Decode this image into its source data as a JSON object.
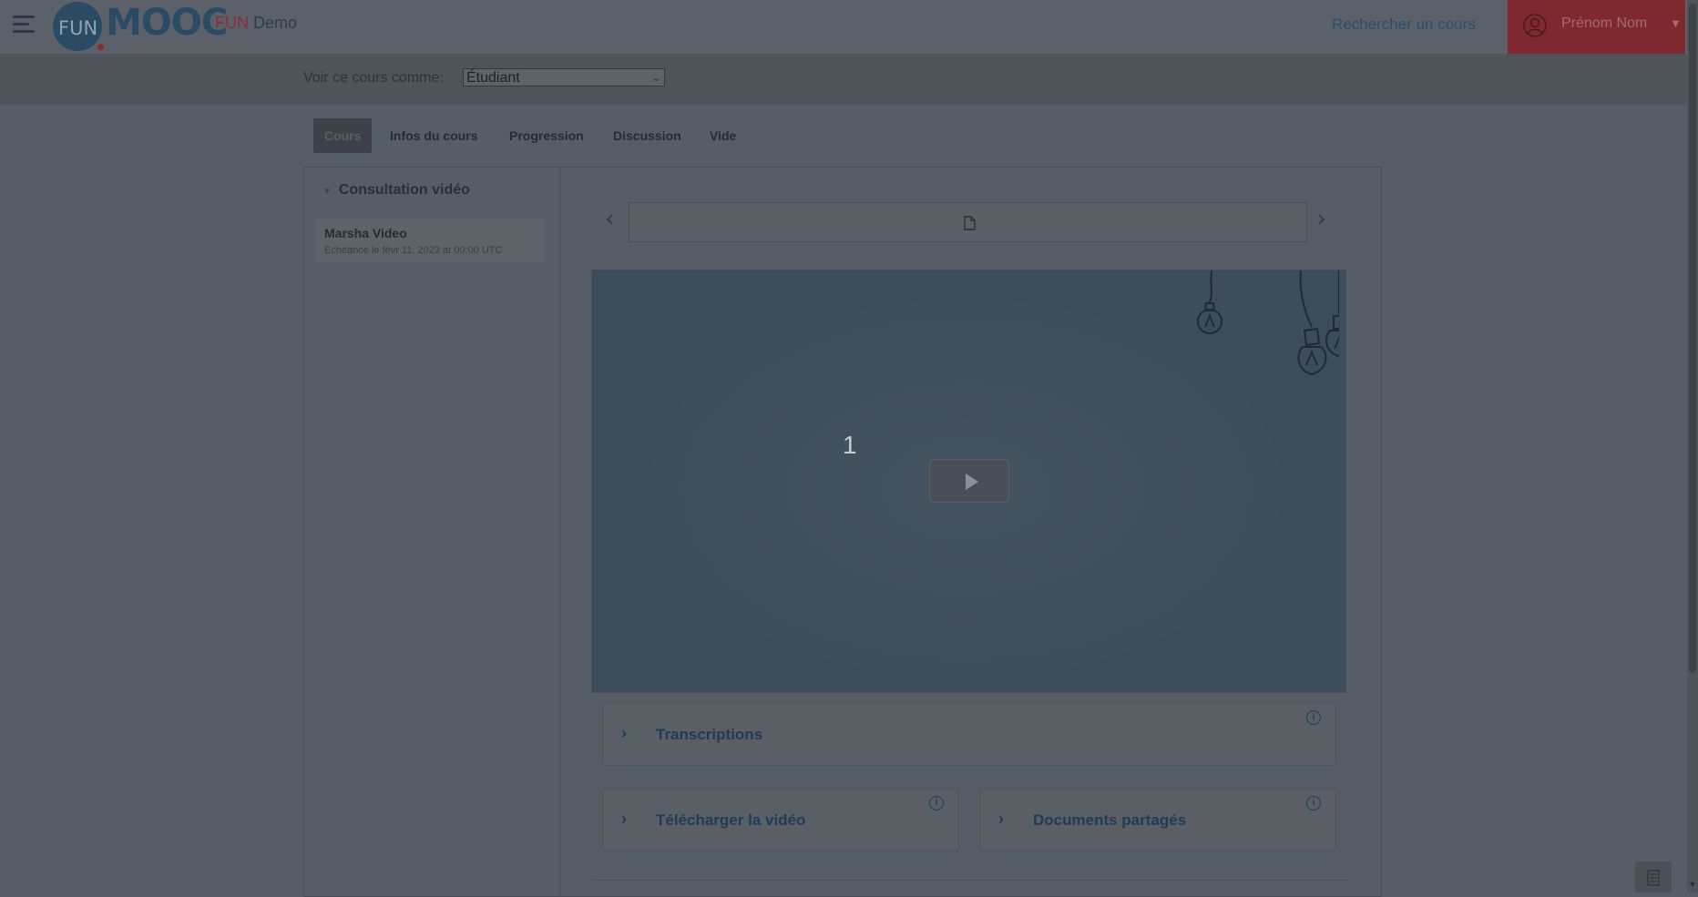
{
  "header": {
    "logo_fun": "FUN",
    "logo_mooc": "MOOC",
    "site_name_brand": "FUN",
    "site_name_suffix": "Demo",
    "search_link": "Rechercher un cours",
    "user_name": "Prénom Nom",
    "user_caret": "▼"
  },
  "masquerade": {
    "label": "Voir ce cours comme:",
    "selected_role": "Étudiant"
  },
  "course_tabs": [
    {
      "label": "Cours",
      "active": true
    },
    {
      "label": "Infos du cours",
      "active": false
    },
    {
      "label": "Progression",
      "active": false
    },
    {
      "label": "Discussion",
      "active": false
    },
    {
      "label": "Vide",
      "active": false
    }
  ],
  "sidebar": {
    "chapter_title": "Consultation vidéo",
    "sequence": {
      "title": "Marsha Video",
      "due": "Echéance le févr 11, 2023 at 00:00 UTC"
    }
  },
  "video": {
    "overlay_number": "1"
  },
  "panels": {
    "transcriptions": "Transcriptions",
    "download": "Télécharger la vidéo",
    "shared_docs": "Documents partagés"
  },
  "colors": {
    "brand_blue": "#2b4a63",
    "brand_red": "#8a2b38",
    "link_blue": "#233a55"
  }
}
